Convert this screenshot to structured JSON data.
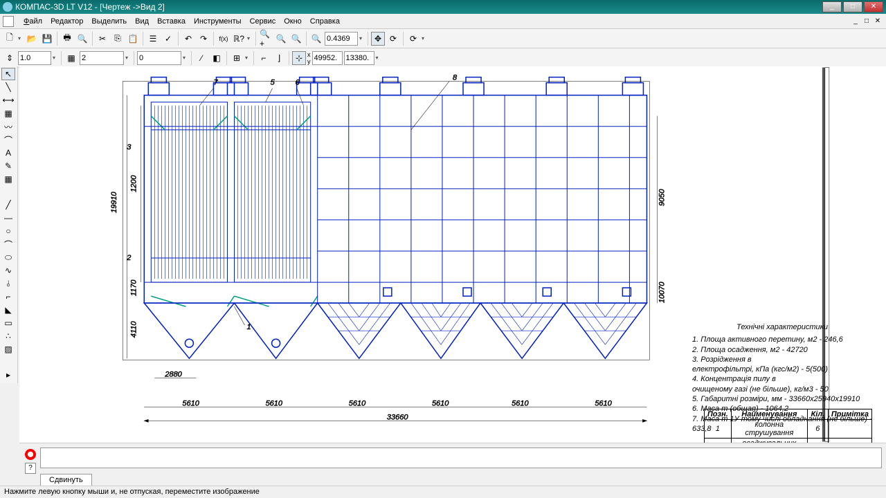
{
  "titlebar": {
    "title": "КОМПАС-3D LT V12 - [Чертеж ->Вид 2]"
  },
  "menu": {
    "file": "Файл",
    "edit": "Редактор",
    "select": "Выделить",
    "view": "Вид",
    "insert": "Вставка",
    "tools": "Инструменты",
    "service": "Сервис",
    "window": "Окно",
    "help": "Справка"
  },
  "toolbar1": {
    "zoom": "0.4369",
    "x": "49952.",
    "y": "13380."
  },
  "toolbar2": {
    "scale": "1.0",
    "layer": "2",
    "style": "0"
  },
  "dims": {
    "w": "33660",
    "seg": "5610",
    "h1": "1200",
    "h2": "19910",
    "h3": "1170",
    "h4": "4110",
    "left": "2880",
    "right1": "10070",
    "right2": "9050"
  },
  "callouts": [
    "1",
    "2",
    "3",
    "5",
    "6",
    "7",
    "8"
  ],
  "tech": {
    "title": "Технічні характеристики",
    "l1": "1. Площа активного перетину, м2 - 246,6",
    "l2": "2. Площа осадження, м2 - 42720",
    "l3": "3. Розрідження в",
    "l4": "електрофільтрі, кПа (кгс/м2) - 5(500)",
    "l5": "4. Концентрація пилу в",
    "l6": "очищеному газі (не більше), кг/м3 - 50",
    "l7": "5. Габаритні розміри, мм - 33660х25940х19910",
    "l8": "6. Маса m (общая) - 1064,2",
    "l9": "7. Маса m 1У тому числі обладнання (не більше) - 633,8"
  },
  "table": {
    "h1": "Позн.",
    "h2": "Найменування",
    "h3": "Кіл.",
    "h4": "Примітка",
    "r1c1": "1",
    "r1c2": "колонна струшування",
    "r1c3": "6",
    "r1c4": "",
    "r2c1": "",
    "r2c2": "осаджувальних електродів",
    "r2c3": "",
    "r2c4": ""
  },
  "bottom": {
    "tab": "Сдвинуть"
  },
  "status": {
    "hint": "Нажмите левую кнопку мыши и, не отпуская, переместите изображение"
  }
}
